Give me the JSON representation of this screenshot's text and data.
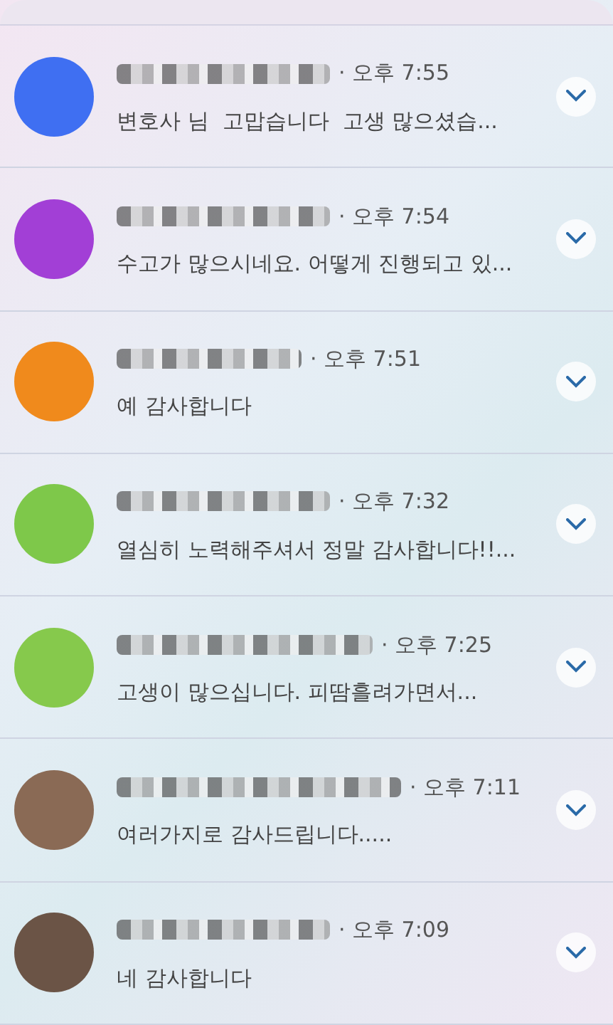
{
  "notifications": [
    {
      "color": "#3f6ff2",
      "time": "· 오후 7:55",
      "message": "변호사 님  고맙습니다  고생 많으셨습..."
    },
    {
      "color": "#a23fd6",
      "time": "· 오후 7:54",
      "message": "수고가 많으시네요. 어떻게 진행되고 있..."
    },
    {
      "color": "#f08a1c",
      "time": "· 오후 7:51",
      "message": "예 감사합니다"
    },
    {
      "color": "#7ec84a",
      "time": "· 오후 7:32",
      "message": "열심히 노력해주셔서 정말 감사합니다!!..."
    },
    {
      "color": "#86c94c",
      "time": "· 오후 7:25",
      "message": "고생이 많으십니다. 피땀흘려가면서..."
    },
    {
      "color": "#8a6a55",
      "time": "· 오후 7:11",
      "message": "여러가지로 감사드립니다....."
    },
    {
      "color": "#6b5446",
      "time": "· 오후 7:09",
      "message": "네 감사합니다"
    }
  ]
}
